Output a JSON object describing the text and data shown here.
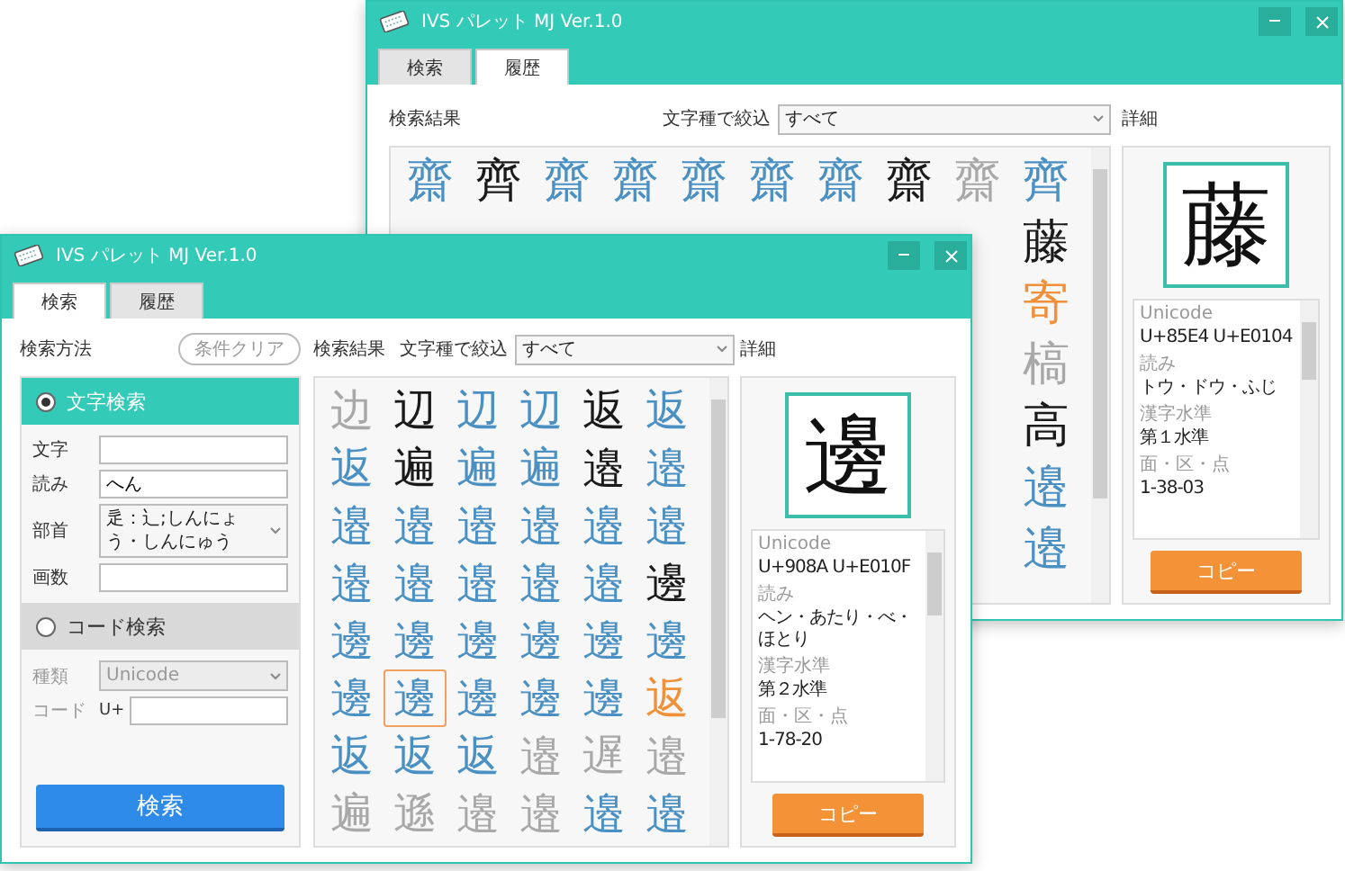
{
  "back_window": {
    "title": "IVS パレット MJ Ver.1.0",
    "tabs": [
      {
        "label": "検索",
        "selected": false
      },
      {
        "label": "履歴",
        "selected": true
      }
    ],
    "results_label": "検索結果",
    "filter": {
      "label": "文字種で絞込",
      "value": "すべて"
    },
    "detail_label": "詳細",
    "results": [
      [
        {
          "ch": "齋",
          "color": "#4a90c2",
          "selected": false
        },
        {
          "ch": "齊",
          "color": "#1a1a1a",
          "selected": false
        },
        {
          "ch": "齋",
          "color": "#4a90c2",
          "selected": false
        },
        {
          "ch": "齋",
          "color": "#4a90c2",
          "selected": false
        },
        {
          "ch": "齋",
          "color": "#4a90c2",
          "selected": false
        },
        {
          "ch": "齋",
          "color": "#4a90c2",
          "selected": false
        },
        {
          "ch": "齋",
          "color": "#4a90c2",
          "selected": false
        },
        {
          "ch": "齋",
          "color": "#1a1a1a",
          "selected": false
        },
        {
          "ch": "齋",
          "color": "#a8a8a8",
          "selected": false
        },
        {
          "ch": "齊",
          "color": "#4a90c2",
          "selected": false
        }
      ],
      [
        {
          "ch": "藤",
          "color": "#1a1a1a",
          "selected": false
        }
      ],
      [
        {
          "ch": "寄",
          "color": "#f0913a",
          "selected": false
        }
      ],
      [
        {
          "ch": "槁",
          "color": "#a8a8a8",
          "selected": false
        }
      ],
      [
        {
          "ch": "高",
          "color": "#1a1a1a",
          "selected": false
        }
      ],
      [
        {
          "ch": "邉",
          "color": "#4a90c2",
          "selected": false
        }
      ],
      [
        {
          "ch": "邉",
          "color": "#4a90c2",
          "selected": false
        }
      ]
    ],
    "detail": {
      "glyph": "藤",
      "info": [
        {
          "label": "Unicode",
          "value": "U+85E4 U+E0104"
        },
        {
          "label": "読み",
          "value": "トウ・ドウ・ふじ"
        },
        {
          "label": "漢字水準",
          "value": "第１水準"
        },
        {
          "label": "面・区・点",
          "value": "1-38-03"
        }
      ],
      "copy_button": "コピー"
    }
  },
  "front_window": {
    "title": "IVS パレット MJ Ver.1.0",
    "tabs": [
      {
        "label": "検索",
        "selected": true
      },
      {
        "label": "履歴",
        "selected": false
      }
    ],
    "search_method_label": "検索方法",
    "clear_button": "条件クリア",
    "sections": [
      {
        "label": "文字検索",
        "selected": true,
        "fields": [
          {
            "label": "文字",
            "kind": "input",
            "disabled": false
          },
          {
            "label": "読み",
            "kind": "input",
            "value": "へん",
            "disabled": false
          },
          {
            "label": "部首",
            "kind": "select",
            "value": "辵：辶;しんにょう・しんにゅう",
            "disabled": false
          },
          {
            "label": "画数",
            "kind": "input",
            "disabled": false
          }
        ]
      },
      {
        "label": "コード検索",
        "selected": false,
        "fields": [
          {
            "label": "種類",
            "kind": "select",
            "value": "Unicode",
            "disabled": true
          },
          {
            "label": "コード",
            "kind": "input",
            "prefix": "U+",
            "disabled": false
          }
        ]
      }
    ],
    "search_button": "検索",
    "results_label": "検索結果",
    "filter": {
      "label": "文字種で絞込",
      "value": "すべて"
    },
    "detail_label": "詳細",
    "results": [
      [
        {
          "ch": "边",
          "color": "#a8a8a8",
          "selected": false
        },
        {
          "ch": "辺",
          "color": "#1a1a1a",
          "selected": false
        },
        {
          "ch": "辺",
          "color": "#4a90c2",
          "selected": false
        },
        {
          "ch": "辺",
          "color": "#4a90c2",
          "selected": false
        },
        {
          "ch": "返",
          "color": "#1a1a1a",
          "selected": false
        },
        {
          "ch": "返",
          "color": "#4a90c2",
          "selected": false
        }
      ],
      [
        {
          "ch": "返",
          "color": "#4a90c2",
          "selected": false
        },
        {
          "ch": "遍",
          "color": "#1a1a1a",
          "selected": false
        },
        {
          "ch": "遍",
          "color": "#4a90c2",
          "selected": false
        },
        {
          "ch": "遍",
          "color": "#4a90c2",
          "selected": false
        },
        {
          "ch": "邉",
          "color": "#1a1a1a",
          "selected": false
        },
        {
          "ch": "邉",
          "color": "#4a90c2",
          "selected": false
        }
      ],
      [
        {
          "ch": "邉",
          "color": "#4a90c2",
          "selected": false
        },
        {
          "ch": "邉",
          "color": "#4a90c2",
          "selected": false
        },
        {
          "ch": "邉",
          "color": "#4a90c2",
          "selected": false
        },
        {
          "ch": "邉",
          "color": "#4a90c2",
          "selected": false
        },
        {
          "ch": "邉",
          "color": "#4a90c2",
          "selected": false
        },
        {
          "ch": "邉",
          "color": "#4a90c2",
          "selected": false
        }
      ],
      [
        {
          "ch": "邉",
          "color": "#4a90c2",
          "selected": false
        },
        {
          "ch": "邉",
          "color": "#4a90c2",
          "selected": false
        },
        {
          "ch": "邉",
          "color": "#4a90c2",
          "selected": false
        },
        {
          "ch": "邉",
          "color": "#4a90c2",
          "selected": false
        },
        {
          "ch": "邉",
          "color": "#4a90c2",
          "selected": false
        },
        {
          "ch": "邊",
          "color": "#1a1a1a",
          "selected": false
        }
      ],
      [
        {
          "ch": "邊",
          "color": "#4a90c2",
          "selected": false
        },
        {
          "ch": "邊",
          "color": "#4a90c2",
          "selected": false
        },
        {
          "ch": "邊",
          "color": "#4a90c2",
          "selected": false
        },
        {
          "ch": "邊",
          "color": "#4a90c2",
          "selected": false
        },
        {
          "ch": "邊",
          "color": "#4a90c2",
          "selected": false
        },
        {
          "ch": "邊",
          "color": "#4a90c2",
          "selected": false
        }
      ],
      [
        {
          "ch": "邊",
          "color": "#4a90c2",
          "selected": false
        },
        {
          "ch": "邊",
          "color": "#4a90c2",
          "selected": true
        },
        {
          "ch": "邊",
          "color": "#4a90c2",
          "selected": false
        },
        {
          "ch": "邊",
          "color": "#4a90c2",
          "selected": false
        },
        {
          "ch": "邊",
          "color": "#4a90c2",
          "selected": false
        },
        {
          "ch": "返",
          "color": "#f0913a",
          "selected": false
        }
      ],
      [
        {
          "ch": "返",
          "color": "#4a90c2",
          "selected": false
        },
        {
          "ch": "返",
          "color": "#4a90c2",
          "selected": false
        },
        {
          "ch": "返",
          "color": "#4a90c2",
          "selected": false
        },
        {
          "ch": "邉",
          "color": "#a8a8a8",
          "selected": false
        },
        {
          "ch": "遅",
          "color": "#a8a8a8",
          "selected": false
        },
        {
          "ch": "邉",
          "color": "#a8a8a8",
          "selected": false
        }
      ],
      [
        {
          "ch": "遍",
          "color": "#a8a8a8",
          "selected": false
        },
        {
          "ch": "遜",
          "color": "#a8a8a8",
          "selected": false
        },
        {
          "ch": "邉",
          "color": "#a8a8a8",
          "selected": false
        },
        {
          "ch": "邉",
          "color": "#a8a8a8",
          "selected": false
        },
        {
          "ch": "邉",
          "color": "#4a90c2",
          "selected": false
        },
        {
          "ch": "邉",
          "color": "#4a90c2",
          "selected": false
        }
      ]
    ],
    "detail": {
      "glyph": "邊",
      "info": [
        {
          "label": "Unicode",
          "value": "U+908A U+E010F"
        },
        {
          "label": "読み",
          "value": "ヘン・あたり・べ・ほとり"
        },
        {
          "label": "漢字水準",
          "value": "第２水準"
        },
        {
          "label": "面・区・点",
          "value": "1-78-20"
        }
      ],
      "copy_button": "コピー"
    }
  }
}
